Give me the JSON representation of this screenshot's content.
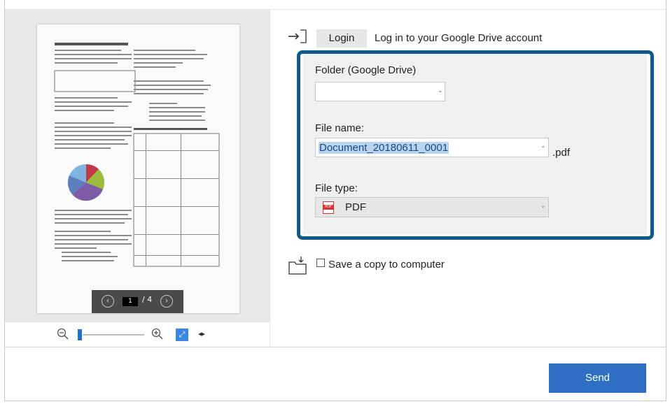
{
  "login": {
    "button_label": "Login",
    "description": "Log in to your Google Drive account"
  },
  "folder": {
    "label": "Folder (Google Drive)",
    "value": ""
  },
  "file_name": {
    "label": "File name:",
    "value": "Document_20180611_0001",
    "extension": ".pdf"
  },
  "file_type": {
    "label": "File type:",
    "value": "PDF",
    "icon": "pdf-file-icon"
  },
  "save_copy": {
    "label": "Save a copy to computer",
    "checked": false
  },
  "preview": {
    "current_page": "1",
    "total_pages": "/ 4",
    "zoom_level": 0.05
  },
  "send": {
    "label": "Send"
  },
  "colors": {
    "accent": "#0f5a8c",
    "send_button": "#2e6fc4"
  }
}
